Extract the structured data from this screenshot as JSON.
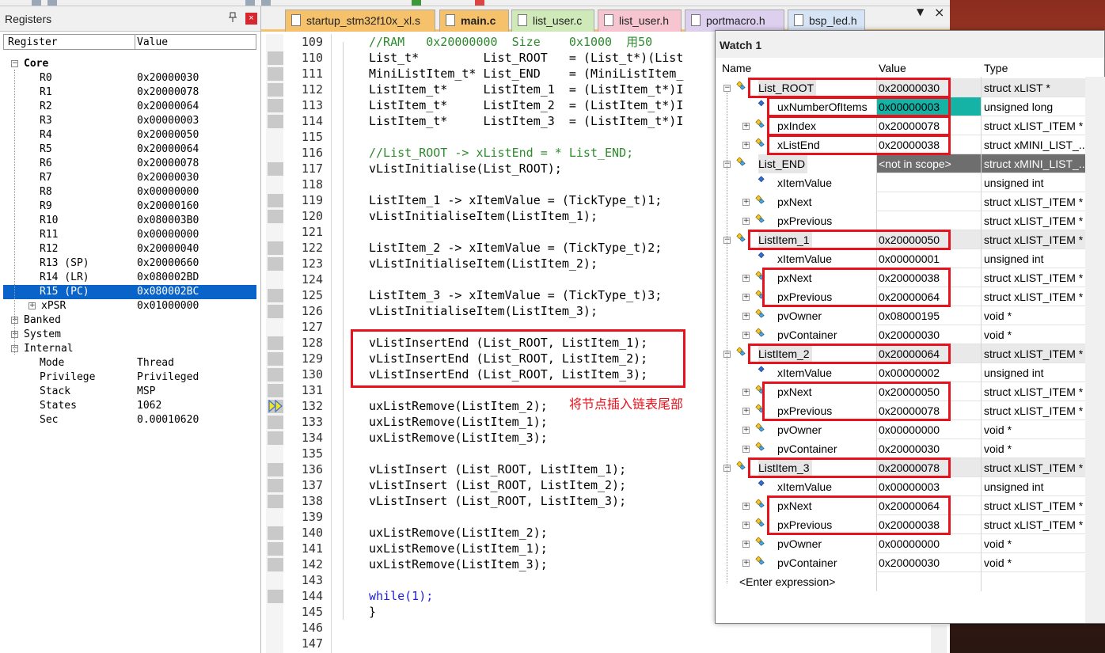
{
  "registers": {
    "title": "Registers",
    "pin_icon": "pin-icon",
    "close_label": "×",
    "columns": {
      "register": "Register",
      "value": "Value"
    },
    "core": {
      "label": "Core",
      "rows": [
        {
          "name": "R0",
          "value": "0x20000030"
        },
        {
          "name": "R1",
          "value": "0x20000078"
        },
        {
          "name": "R2",
          "value": "0x20000064"
        },
        {
          "name": "R3",
          "value": "0x00000003"
        },
        {
          "name": "R4",
          "value": "0x20000050"
        },
        {
          "name": "R5",
          "value": "0x20000064"
        },
        {
          "name": "R6",
          "value": "0x20000078"
        },
        {
          "name": "R7",
          "value": "0x20000030"
        },
        {
          "name": "R8",
          "value": "0x00000000"
        },
        {
          "name": "R9",
          "value": "0x20000160"
        },
        {
          "name": "R10",
          "value": "0x080003B0"
        },
        {
          "name": "R11",
          "value": "0x00000000"
        },
        {
          "name": "R12",
          "value": "0x20000040"
        },
        {
          "name": "R13 (SP)",
          "value": "0x20000660"
        },
        {
          "name": "R14 (LR)",
          "value": "0x080002BD"
        },
        {
          "name": "R15 (PC)",
          "value": "0x080002BC"
        },
        {
          "name": "xPSR",
          "value": "0x01000000"
        }
      ]
    },
    "banked": "Banked",
    "system": "System",
    "internal": {
      "label": "Internal",
      "rows": [
        {
          "name": "Mode",
          "value": "Thread"
        },
        {
          "name": "Privilege",
          "value": "Privileged"
        },
        {
          "name": "Stack",
          "value": "MSP"
        },
        {
          "name": "States",
          "value": "1062"
        },
        {
          "name": "Sec",
          "value": "0.00010620"
        }
      ]
    }
  },
  "tabs": [
    {
      "label": "startup_stm32f10x_xl.s",
      "color": "#f5c26b"
    },
    {
      "label": "main.c",
      "color": "#f5c26b"
    },
    {
      "label": "list_user.c",
      "color": "#cfe9b8"
    },
    {
      "label": "list_user.h",
      "color": "#f6c5cf"
    },
    {
      "label": "portmacro.h",
      "color": "#ddd0ef"
    },
    {
      "label": "bsp_led.h",
      "color": "#d6e4f5"
    }
  ],
  "tabs_close": "×",
  "tabs_dropdown": "▼",
  "code": [
    {
      "ln": "109",
      "text": "//RAM   0x20000000  Size    0x1000  用50",
      "cls": "comment"
    },
    {
      "ln": "110",
      "text": "List_t*         List_ROOT   = (List_t*)(List",
      "cls": ""
    },
    {
      "ln": "111",
      "text": "MiniListItem_t* List_END    = (MiniListItem_",
      "cls": ""
    },
    {
      "ln": "112",
      "text": "ListItem_t*     ListItem_1  = (ListItem_t*)I",
      "cls": ""
    },
    {
      "ln": "113",
      "text": "ListItem_t*     ListItem_2  = (ListItem_t*)I",
      "cls": ""
    },
    {
      "ln": "114",
      "text": "ListItem_t*     ListItem_3  = (ListItem_t*)I",
      "cls": ""
    },
    {
      "ln": "115",
      "text": "",
      "cls": ""
    },
    {
      "ln": "116",
      "text": "//List_ROOT -> xListEnd = * List_END;",
      "cls": "comment"
    },
    {
      "ln": "117",
      "text": "vListInitialise(List_ROOT);",
      "cls": ""
    },
    {
      "ln": "118",
      "text": "",
      "cls": ""
    },
    {
      "ln": "119",
      "text": "ListItem_1 -> xItemValue = (TickType_t)1;",
      "cls": ""
    },
    {
      "ln": "120",
      "text": "vListInitialiseItem(ListItem_1);",
      "cls": ""
    },
    {
      "ln": "121",
      "text": "",
      "cls": ""
    },
    {
      "ln": "122",
      "text": "ListItem_2 -> xItemValue = (TickType_t)2;",
      "cls": ""
    },
    {
      "ln": "123",
      "text": "vListInitialiseItem(ListItem_2);",
      "cls": ""
    },
    {
      "ln": "124",
      "text": "",
      "cls": ""
    },
    {
      "ln": "125",
      "text": "ListItem_3 -> xItemValue = (TickType_t)3;",
      "cls": ""
    },
    {
      "ln": "126",
      "text": "vListInitialiseItem(ListItem_3);",
      "cls": ""
    },
    {
      "ln": "127",
      "text": "",
      "cls": ""
    },
    {
      "ln": "128",
      "text": "vListInsertEnd (List_ROOT, ListItem_1);",
      "cls": ""
    },
    {
      "ln": "129",
      "text": "vListInsertEnd (List_ROOT, ListItem_2);",
      "cls": ""
    },
    {
      "ln": "130",
      "text": "vListInsertEnd (List_ROOT, ListItem_3);",
      "cls": ""
    },
    {
      "ln": "131",
      "text": "",
      "cls": ""
    },
    {
      "ln": "132",
      "text": "uxListRemove(ListItem_2);",
      "cls": ""
    },
    {
      "ln": "133",
      "text": "uxListRemove(ListItem_1);",
      "cls": ""
    },
    {
      "ln": "134",
      "text": "uxListRemove(ListItem_3);",
      "cls": ""
    },
    {
      "ln": "135",
      "text": "",
      "cls": ""
    },
    {
      "ln": "136",
      "text": "vListInsert (List_ROOT, ListItem_1);",
      "cls": ""
    },
    {
      "ln": "137",
      "text": "vListInsert (List_ROOT, ListItem_2);",
      "cls": ""
    },
    {
      "ln": "138",
      "text": "vListInsert (List_ROOT, ListItem_3);",
      "cls": ""
    },
    {
      "ln": "139",
      "text": "",
      "cls": ""
    },
    {
      "ln": "140",
      "text": "uxListRemove(ListItem_2);",
      "cls": ""
    },
    {
      "ln": "141",
      "text": "uxListRemove(ListItem_1);",
      "cls": ""
    },
    {
      "ln": "142",
      "text": "uxListRemove(ListItem_3);",
      "cls": ""
    },
    {
      "ln": "143",
      "text": "",
      "cls": ""
    },
    {
      "ln": "144",
      "text": "while(1);",
      "cls": "kw"
    },
    {
      "ln": "145",
      "text": "}",
      "cls": ""
    },
    {
      "ln": "146",
      "text": "",
      "cls": ""
    },
    {
      "ln": "147",
      "text": "",
      "cls": ""
    }
  ],
  "annotation": "将节点插入链表尾部",
  "watch": {
    "title": "Watch 1",
    "columns": {
      "name": "Name",
      "value": "Value",
      "type": "Type"
    },
    "rows": [
      {
        "name": "List_ROOT",
        "value": "0x20000030",
        "type": "struct xLIST *",
        "level": 0,
        "exp": "−",
        "root": true
      },
      {
        "name": "uxNumberOfItems",
        "value": "0x00000003",
        "type": "unsigned long",
        "level": 1,
        "exp": "",
        "root": false,
        "hl": true
      },
      {
        "name": "pxIndex",
        "value": "0x20000078",
        "type": "struct xLIST_ITEM *",
        "level": 1,
        "exp": "+",
        "root": false
      },
      {
        "name": "xListEnd",
        "value": "0x20000038",
        "type": "struct xMINI_LIST_...",
        "level": 1,
        "exp": "+",
        "root": false
      },
      {
        "name": "List_END",
        "value": "<not in scope>",
        "type": "struct xMINI_LIST_...",
        "level": 0,
        "exp": "−",
        "root": true,
        "dark": true
      },
      {
        "name": "xItemValue",
        "value": "",
        "type": "unsigned int",
        "level": 1,
        "exp": "",
        "root": false
      },
      {
        "name": "pxNext",
        "value": "",
        "type": "struct xLIST_ITEM *",
        "level": 1,
        "exp": "+",
        "root": false
      },
      {
        "name": "pxPrevious",
        "value": "",
        "type": "struct xLIST_ITEM *",
        "level": 1,
        "exp": "+",
        "root": false
      },
      {
        "name": "ListItem_1",
        "value": "0x20000050",
        "type": "struct xLIST_ITEM *",
        "level": 0,
        "exp": "−",
        "root": true
      },
      {
        "name": "xItemValue",
        "value": "0x00000001",
        "type": "unsigned int",
        "level": 1,
        "exp": "",
        "root": false
      },
      {
        "name": "pxNext",
        "value": "0x20000038",
        "type": "struct xLIST_ITEM *",
        "level": 1,
        "exp": "+",
        "root": false
      },
      {
        "name": "pxPrevious",
        "value": "0x20000064",
        "type": "struct xLIST_ITEM *",
        "level": 1,
        "exp": "+",
        "root": false
      },
      {
        "name": "pvOwner",
        "value": "0x08000195",
        "type": "void *",
        "level": 1,
        "exp": "+",
        "root": false
      },
      {
        "name": "pvContainer",
        "value": "0x20000030",
        "type": "void *",
        "level": 1,
        "exp": "+",
        "root": false
      },
      {
        "name": "ListItem_2",
        "value": "0x20000064",
        "type": "struct xLIST_ITEM *",
        "level": 0,
        "exp": "−",
        "root": true
      },
      {
        "name": "xItemValue",
        "value": "0x00000002",
        "type": "unsigned int",
        "level": 1,
        "exp": "",
        "root": false
      },
      {
        "name": "pxNext",
        "value": "0x20000050",
        "type": "struct xLIST_ITEM *",
        "level": 1,
        "exp": "+",
        "root": false
      },
      {
        "name": "pxPrevious",
        "value": "0x20000078",
        "type": "struct xLIST_ITEM *",
        "level": 1,
        "exp": "+",
        "root": false
      },
      {
        "name": "pvOwner",
        "value": "0x00000000",
        "type": "void *",
        "level": 1,
        "exp": "+",
        "root": false
      },
      {
        "name": "pvContainer",
        "value": "0x20000030",
        "type": "void *",
        "level": 1,
        "exp": "+",
        "root": false
      },
      {
        "name": "ListItem_3",
        "value": "0x20000078",
        "type": "struct xLIST_ITEM *",
        "level": 0,
        "exp": "−",
        "root": true
      },
      {
        "name": "xItemValue",
        "value": "0x00000003",
        "type": "unsigned int",
        "level": 1,
        "exp": "",
        "root": false
      },
      {
        "name": "pxNext",
        "value": "0x20000064",
        "type": "struct xLIST_ITEM *",
        "level": 1,
        "exp": "+",
        "root": false
      },
      {
        "name": "pxPrevious",
        "value": "0x20000038",
        "type": "struct xLIST_ITEM *",
        "level": 1,
        "exp": "+",
        "root": false
      },
      {
        "name": "pvOwner",
        "value": "0x00000000",
        "type": "void *",
        "level": 1,
        "exp": "+",
        "root": false
      },
      {
        "name": "pvContainer",
        "value": "0x20000030",
        "type": "void *",
        "level": 1,
        "exp": "+",
        "root": false
      }
    ],
    "enter_expression": "<Enter expression>"
  },
  "colors": {
    "highlight_red": "#e8121c",
    "selection_blue": "#0a63c8",
    "teal_highlight": "#14b3a6",
    "comment_green": "#2e8b2e",
    "keyword_blue": "#1f1fd6",
    "not_in_scope_bg": "#6e6e6e"
  }
}
